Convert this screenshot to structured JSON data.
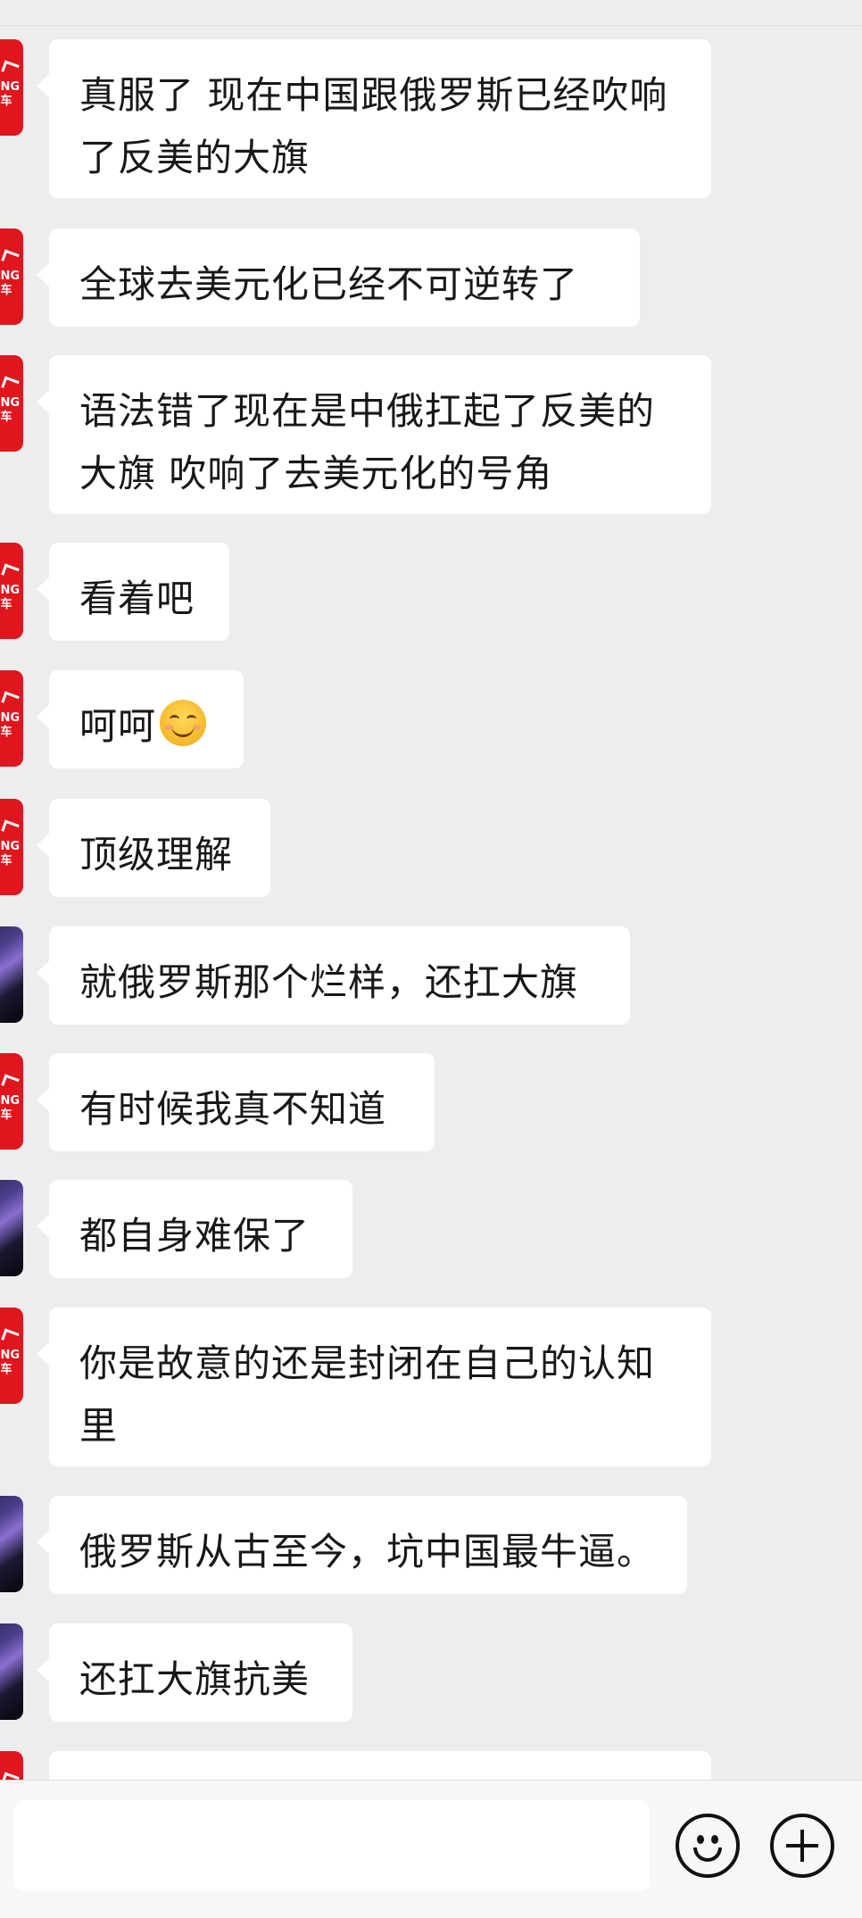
{
  "messages": [
    {
      "avatar": "red-logo-avatar",
      "text": "真服了 现在中国跟俄罗斯已经吹响了反美的大旗"
    },
    {
      "avatar": "red-logo-avatar",
      "text": "全球去美元化已经不可逆转了"
    },
    {
      "avatar": "red-logo-avatar",
      "text": "语法错了现在是中俄扛起了反美的大旗 吹响了去美元化的号角"
    },
    {
      "avatar": "red-logo-avatar",
      "text": "看着吧"
    },
    {
      "avatar": "red-logo-avatar",
      "text": "呵呵",
      "emoji": "smiling-face-emoji"
    },
    {
      "avatar": "red-logo-avatar",
      "text": "顶级理解"
    },
    {
      "avatar": "car-photo-avatar",
      "text": "就俄罗斯那个烂样，还扛大旗"
    },
    {
      "avatar": "red-logo-avatar",
      "text": "有时候我真不知道"
    },
    {
      "avatar": "car-photo-avatar",
      "text": "都自身难保了"
    },
    {
      "avatar": "red-logo-avatar",
      "text": "你是故意的还是封闭在自己的认知里"
    },
    {
      "avatar": "car-photo-avatar",
      "text": "俄罗斯从古至今，坑中国最牛逼。"
    },
    {
      "avatar": "car-photo-avatar",
      "text": "还扛大旗抗美"
    },
    {
      "avatar": "red-logo-avatar",
      "text": ""
    }
  ],
  "avatar_logo": {
    "line1": "NG",
    "line2": "车"
  },
  "input": {
    "placeholder": "",
    "emoji_icon": "emoji-face-icon",
    "add_icon": "plus-circle-icon"
  }
}
